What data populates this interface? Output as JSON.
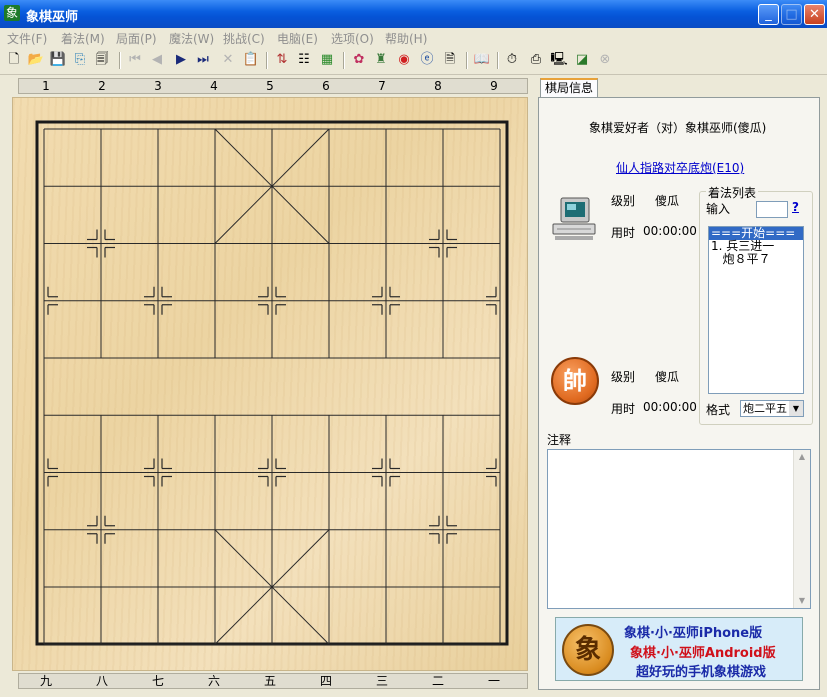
{
  "window": {
    "title": "象棋巫师",
    "app_icon_glyph": "象",
    "icons": [
      "minimize-icon",
      "maximize-icon",
      "close-icon"
    ]
  },
  "menu": [
    "文件(F)",
    "着法(M)",
    "局面(P)",
    "魔法(W)",
    "挑战(C)",
    "电脑(E)",
    "选项(O)",
    "帮助(H)"
  ],
  "toolbar": {
    "icons": [
      "new-icon",
      "open-icon",
      "save-icon",
      "save-as-icon",
      "properties-icon",
      "first-move-icon",
      "prev-move-icon",
      "next-move-icon",
      "last-move-icon",
      "delete-icon",
      "paste-icon",
      "flip-icon",
      "tree-icon",
      "grid-icon",
      "palette-icon",
      "analysis-icon",
      "network-icon",
      "browser-icon",
      "export-icon",
      "book-icon",
      "clock-icon",
      "print-icon",
      "monitor-icon",
      "chart-icon",
      "stop-icon"
    ]
  },
  "board": {
    "top_coords": [
      "1",
      "2",
      "3",
      "4",
      "5",
      "6",
      "7",
      "8",
      "9"
    ],
    "bottom_coords": [
      "九",
      "八",
      "七",
      "六",
      "五",
      "四",
      "三",
      "二",
      "一"
    ]
  },
  "panel": {
    "tab_label": "棋局信息",
    "match_title": "象棋爱好者（对）象棋巫师(傻瓜)",
    "opening_link": "仙人指路对卒底炮(E10)",
    "top_player": {
      "level_label": "级别",
      "level_value": "傻瓜",
      "time_label": "用时",
      "time_value": "00:00:00"
    },
    "bottom_player": {
      "avatar_glyph": "帥",
      "level_label": "级别",
      "level_value": "傻瓜",
      "time_label": "用时",
      "time_value": "00:00:00"
    },
    "movelist": {
      "legend": "着法列表",
      "input_label": "输入",
      "input_value": "",
      "help_label": "?",
      "items": [
        "===开始===",
        "1. 兵三进一",
        "   炮８平７"
      ],
      "selected_index": 0,
      "format_label": "格式",
      "format_value": "炮二平五"
    },
    "notes_label": "注释",
    "notes_value": ""
  },
  "banner": {
    "logo_glyph": "象",
    "line1": "象棋·小·巫师iPhone版",
    "line2": "象棋·小·巫师Android版",
    "line3": "超好玩的手机象棋游戏",
    "colors": {
      "line1": "#1a2aa8",
      "line2": "#d0101a",
      "line3": "#1a2aa8"
    }
  }
}
